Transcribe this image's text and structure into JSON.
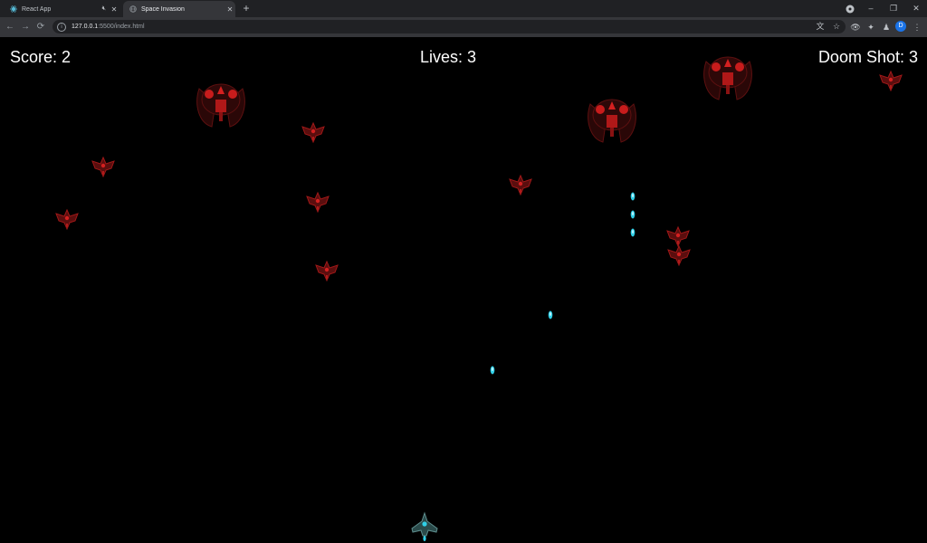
{
  "browser": {
    "tabs": [
      {
        "title": "React App",
        "active": false
      },
      {
        "title": "Space Invasion",
        "active": true
      }
    ],
    "url_host": "127.0.0.1",
    "url_rest": ":5500/index.html"
  },
  "hud": {
    "score_label": "Score: 2",
    "lives_label": "Lives: 3",
    "doom_label": "Doom Shot: 3"
  },
  "colors": {
    "background": "#000000",
    "enemy_red": "#a01818",
    "boss_red": "#d42020",
    "laser_cyan": "#30d0e8",
    "player_teal": "#3a6a6a"
  }
}
